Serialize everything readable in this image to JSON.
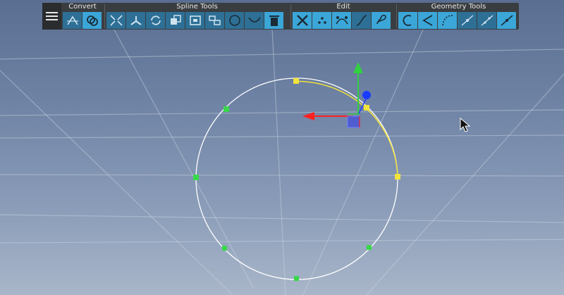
{
  "toolbar": {
    "menu_icon": "hamburger-menu-icon",
    "groups": [
      {
        "label": "Convert",
        "buttons": [
          "convert-to-spline-icon",
          "convert-to-mesh-icon"
        ]
      },
      {
        "label": "Spline Tools",
        "buttons": [
          "split-knots-icon",
          "join-spline-icon",
          "reverse-spline-icon",
          "duplicate-icon",
          "frame-icon",
          "snap-icon",
          "circle-icon",
          "arc-icon",
          "delete-icon"
        ]
      },
      {
        "label": "Edit",
        "buttons": [
          "cut-icon",
          "points-icon",
          "bezier-handles-icon",
          "linear-icon",
          "loop-icon"
        ]
      },
      {
        "label": "Geometry Tools",
        "buttons": [
          "close-curve-icon",
          "corner-icon",
          "dashed-curve-icon",
          "align-icon",
          "stretch-icon",
          "straighten-icon"
        ]
      }
    ]
  },
  "colors": {
    "toolbar_bg": "#3a3d40",
    "button": "#2e6f95",
    "button_active": "#3ba6d8",
    "selected_knot": "#f2e33a",
    "knot": "#39d84a",
    "spline": "#ffffff",
    "axis_x": "#ff2020",
    "axis_y": "#30d040",
    "axis_z": "#1a3cff"
  }
}
